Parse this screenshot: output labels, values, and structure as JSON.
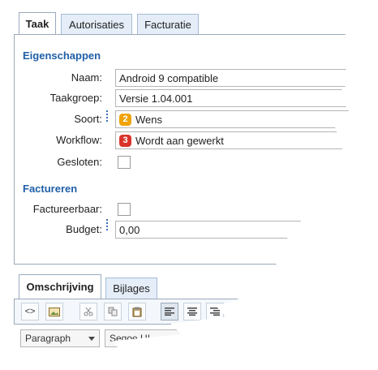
{
  "tabs": [
    "Taak",
    "Autorisaties",
    "Facturatie"
  ],
  "sections": {
    "properties": "Eigenschappen",
    "invoicing": "Factureren"
  },
  "fields": {
    "name": {
      "label": "Naam:",
      "value": "Android 9 compatible"
    },
    "taskgroup": {
      "label": "Taakgroep:",
      "value": "Versie 1.04.001"
    },
    "type": {
      "label": "Soort:",
      "badge": "2",
      "badge_color": "#f0a30a",
      "value": "Wens"
    },
    "workflow": {
      "label": "Workflow:",
      "badge": "3",
      "badge_color": "#d9342b",
      "value": "Wordt aan gewerkt"
    },
    "closed": {
      "label": "Gesloten:",
      "checked": false
    },
    "billable": {
      "label": "Factureerbaar:",
      "checked": false
    },
    "budget": {
      "label": "Budget:",
      "value": "0,00"
    }
  },
  "bottom_tabs": [
    "Omschrijving",
    "Bijlages"
  ],
  "toolbar": {
    "source_label": "<>",
    "buttons": [
      "source-code",
      "image",
      "cut",
      "copy",
      "paste",
      "align-left",
      "align-center",
      "align-right"
    ]
  },
  "format": {
    "paragraph": "Paragraph",
    "font": "Segoe UI"
  }
}
